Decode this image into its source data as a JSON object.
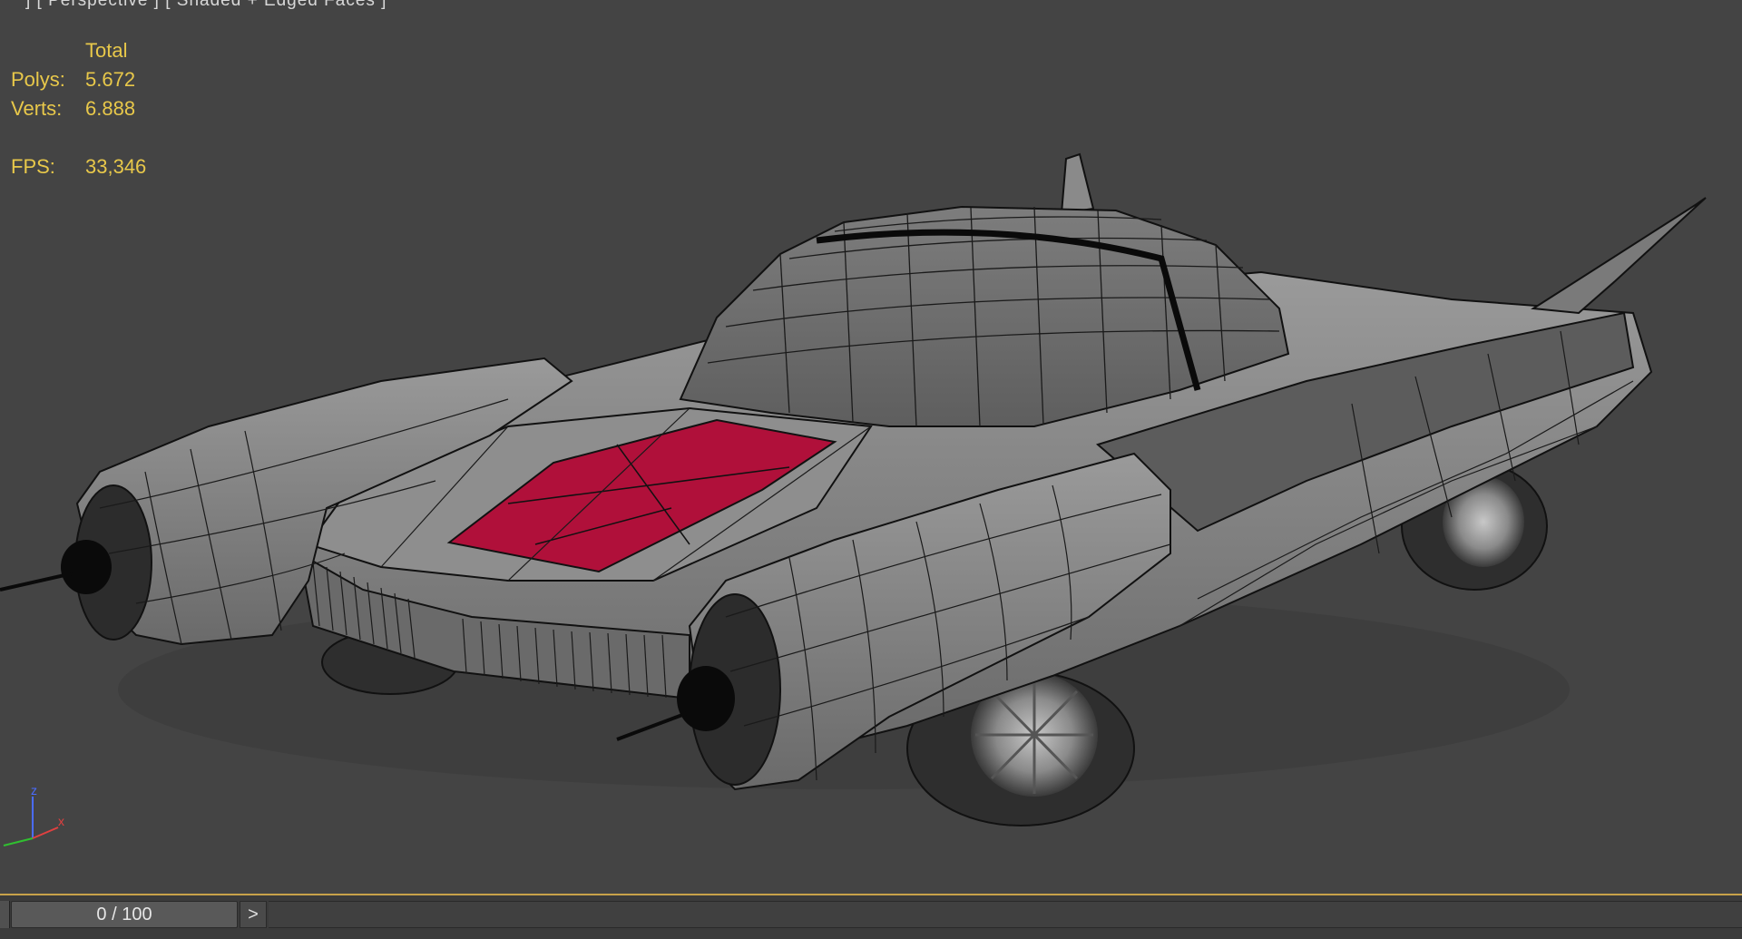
{
  "viewport": {
    "label": "] [ Perspective ] [ Shaded + Edged Faces ]"
  },
  "stats": {
    "header": "Total",
    "polys_label": "Polys:",
    "polys_value": "5.672",
    "verts_label": "Verts:",
    "verts_value": "6.888",
    "fps_label": "FPS:",
    "fps_value": "33,346"
  },
  "gizmo": {
    "z": "z",
    "x": "x"
  },
  "timeline": {
    "frame": "0 / 100",
    "next": ">"
  },
  "colors": {
    "viewport_bg": "#444444",
    "stats_text": "#e8c84a",
    "highlight": "#b0103a",
    "timeline_accent": "#c8a24a"
  }
}
